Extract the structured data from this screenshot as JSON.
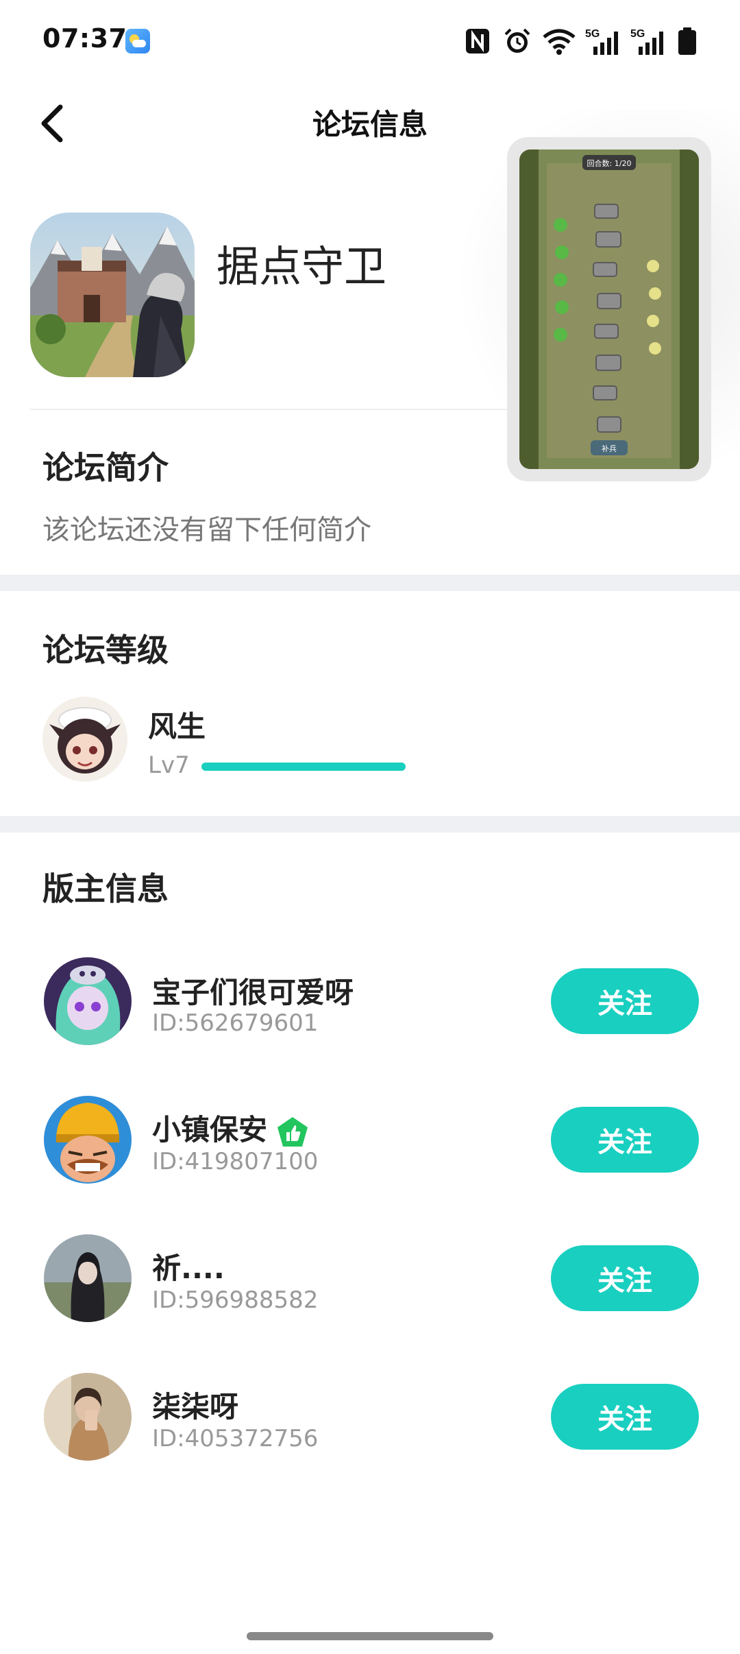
{
  "status_bar": {
    "time": "07:37",
    "network_labels": [
      "5G",
      "5G"
    ]
  },
  "nav": {
    "title": "论坛信息"
  },
  "game": {
    "name": "据点守卫"
  },
  "preview": {
    "round_text": "回合数: 1/20",
    "bottom_button": "补兵"
  },
  "intro": {
    "title": "论坛简介",
    "text": "该论坛还没有留下任何简介"
  },
  "level": {
    "title": "论坛等级",
    "name": "风生",
    "lv": "Lv7",
    "progress": 1.0
  },
  "moderators": {
    "title": "版主信息",
    "follow_label": "关注",
    "items": [
      {
        "name": "宝子们很可爱呀",
        "id": "ID:562679601"
      },
      {
        "name": "小镇保安",
        "id": "ID:419807100",
        "badge": "green-thumbs-up-badge"
      },
      {
        "name": "祈....",
        "id": "ID:596988582"
      },
      {
        "name": "柒柒呀",
        "id": "ID:405372756"
      }
    ]
  },
  "colors": {
    "accent": "#19cfc0",
    "badge": "#22c55e",
    "section_band": "#eef0f3"
  }
}
